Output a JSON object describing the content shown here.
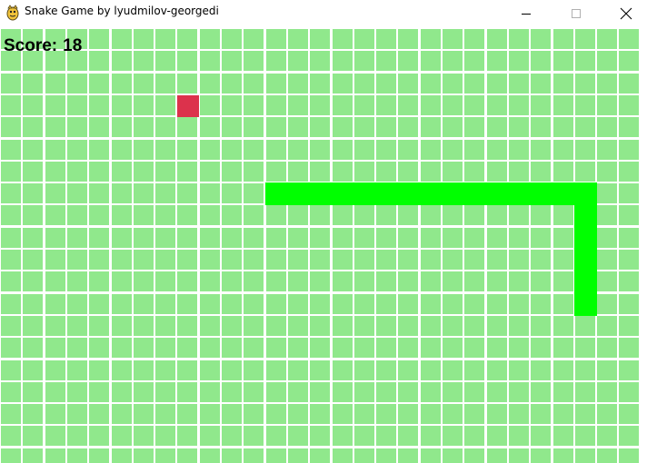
{
  "window": {
    "title": "Snake Game by lyudmilov-georgedi",
    "app_icon": "python-snake-icon",
    "controls": {
      "minimize": "minimize-icon",
      "maximize": "maximize-icon",
      "close": "close-icon"
    }
  },
  "game": {
    "score_label": "Score:",
    "score_value": "18",
    "grid_columns": 29,
    "grid_rows": 20,
    "colors": {
      "cell": "#90e88c",
      "grid_line": "#ffffff",
      "snake": "#00ff00",
      "food": "#dc324c"
    },
    "snake_segments": [
      {
        "col": 26,
        "row": 12
      },
      {
        "col": 26,
        "row": 11
      },
      {
        "col": 26,
        "row": 10
      },
      {
        "col": 26,
        "row": 9
      },
      {
        "col": 26,
        "row": 8
      },
      {
        "col": 25,
        "row": 7
      },
      {
        "col": 24,
        "row": 7
      },
      {
        "col": 23,
        "row": 7
      },
      {
        "col": 22,
        "row": 7
      },
      {
        "col": 21,
        "row": 7
      },
      {
        "col": 20,
        "row": 7
      },
      {
        "col": 19,
        "row": 7
      },
      {
        "col": 18,
        "row": 7
      },
      {
        "col": 17,
        "row": 7
      },
      {
        "col": 16,
        "row": 7
      },
      {
        "col": 15,
        "row": 7
      },
      {
        "col": 14,
        "row": 7
      },
      {
        "col": 13,
        "row": 7
      },
      {
        "col": 12,
        "row": 7
      },
      {
        "col": 26,
        "row": 7
      }
    ],
    "food": {
      "col": 8,
      "row": 3
    }
  }
}
